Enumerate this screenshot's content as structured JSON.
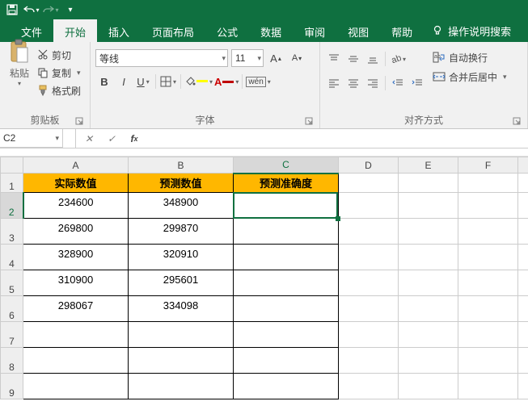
{
  "titlebar": {
    "app": "Excel"
  },
  "tabs": {
    "file": "文件",
    "home": "开始",
    "insert": "插入",
    "layout": "页面布局",
    "formula": "公式",
    "data": "数据",
    "review": "审阅",
    "view": "视图",
    "help": "帮助",
    "tellme": "操作说明搜索"
  },
  "ribbon": {
    "clipboard": {
      "paste": "粘贴",
      "cut": "剪切",
      "copy": "复制",
      "painter": "格式刷",
      "label": "剪贴板"
    },
    "font": {
      "name": "等线",
      "size": "11",
      "label": "字体"
    },
    "align": {
      "wrap": "自动换行",
      "merge": "合并后居中",
      "label": "对齐方式"
    }
  },
  "namebox": "C2",
  "columns": [
    "A",
    "B",
    "C",
    "D",
    "E",
    "F",
    ""
  ],
  "rows": [
    "1",
    "2",
    "3",
    "4",
    "5",
    "6",
    "7",
    "8",
    "9"
  ],
  "headers": {
    "A": "实际数值",
    "B": "预测数值",
    "C": "预测准确度"
  },
  "data": [
    {
      "A": "234600",
      "B": "348900"
    },
    {
      "A": "269800",
      "B": "299870"
    },
    {
      "A": "328900",
      "B": "320910"
    },
    {
      "A": "310900",
      "B": "295601"
    },
    {
      "A": "298067",
      "B": "334098"
    }
  ],
  "active": {
    "col": "C",
    "row": 2
  },
  "colors": {
    "accent": "#0f7040",
    "header_bg": "#ffb700"
  }
}
